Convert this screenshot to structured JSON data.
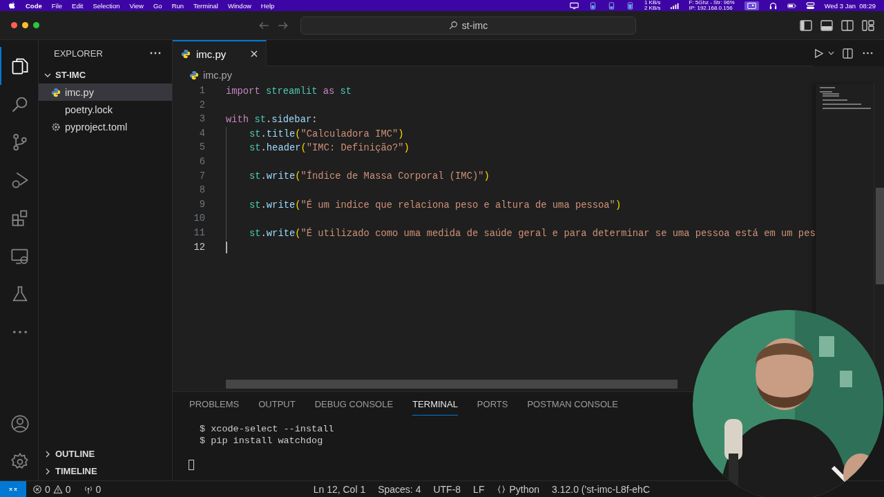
{
  "menu_bar": {
    "app": "Code",
    "items": [
      "File",
      "Edit",
      "Selection",
      "View",
      "Go",
      "Run",
      "Terminal",
      "Window",
      "Help"
    ],
    "net_speed": [
      "1 KB/s",
      "2 KB/s"
    ],
    "wifi_info": [
      "F: 5Ghz - Str: 96%",
      "IP: 192.168.0.156"
    ],
    "clock": "Wed 3 Jan  08:29"
  },
  "title_bar": {
    "search": "st-imc"
  },
  "activity_bar": {
    "items": [
      {
        "kind": "explorer",
        "selected": true
      },
      {
        "kind": "search",
        "selected": false
      },
      {
        "kind": "source-control",
        "selected": false
      },
      {
        "kind": "run-debug",
        "selected": false
      },
      {
        "kind": "extensions",
        "selected": false
      },
      {
        "kind": "remote",
        "selected": false
      },
      {
        "kind": "testing",
        "selected": false
      },
      {
        "kind": "more",
        "selected": false
      }
    ],
    "bottom": [
      {
        "kind": "account"
      },
      {
        "kind": "settings"
      }
    ]
  },
  "sidebar": {
    "title": "EXPLORER",
    "folder": {
      "name": "ST-IMC",
      "expanded": true,
      "files": [
        {
          "name": "imc.py",
          "kind": "python",
          "selected": true
        },
        {
          "name": "poetry.lock",
          "kind": "plain",
          "selected": false
        },
        {
          "name": "pyproject.toml",
          "kind": "config",
          "selected": false
        }
      ]
    },
    "sections": [
      {
        "name": "OUTLINE",
        "expanded": false
      },
      {
        "name": "TIMELINE",
        "expanded": false
      }
    ]
  },
  "editor": {
    "tabs": [
      {
        "label": "imc.py",
        "selected": true
      }
    ],
    "breadcrumb": "imc.py",
    "lines": [
      {
        "number": "1",
        "active": false,
        "tokens": [
          {
            "kind": "keyword",
            "text": "import"
          },
          {
            "kind": "module",
            "text": "streamlit"
          },
          {
            "kind": "keyword",
            "text": "as"
          },
          {
            "kind": "module",
            "text": "st"
          }
        ]
      },
      {
        "number": "2",
        "active": false
      },
      {
        "number": "3",
        "active": false,
        "tokens": [
          {
            "kind": "keyword",
            "text": "with"
          },
          {
            "kind": "module",
            "text": "st"
          },
          {
            "kind": "plain",
            "text": "."
          },
          {
            "kind": "attr",
            "text": "sidebar"
          },
          {
            "kind": "plain",
            "text": ":"
          }
        ],
        "children": [
          {
            "number": "4",
            "active": false,
            "tokens": [
              {
                "kind": "module",
                "text": "st"
              },
              {
                "kind": "plain",
                "text": "."
              },
              {
                "kind": "attr",
                "text": "title"
              },
              {
                "kind": "paren",
                "text": "("
              },
              {
                "kind": "string",
                "text": "\"Calculadora IMC\""
              },
              {
                "kind": "paren",
                "text": ")"
              }
            ]
          },
          {
            "number": "5",
            "active": false,
            "tokens": [
              {
                "kind": "module",
                "text": "st"
              },
              {
                "kind": "plain",
                "text": "."
              },
              {
                "kind": "attr",
                "text": "header"
              },
              {
                "kind": "paren",
                "text": "("
              },
              {
                "kind": "string",
                "text": "\"IMC: Definição?\""
              },
              {
                "kind": "paren",
                "text": ")"
              }
            ]
          },
          {
            "number": "6",
            "active": false
          },
          {
            "number": "7",
            "active": false,
            "tokens": [
              {
                "kind": "module",
                "text": "st"
              },
              {
                "kind": "plain",
                "text": "."
              },
              {
                "kind": "attr",
                "text": "write"
              },
              {
                "kind": "paren",
                "text": "("
              },
              {
                "kind": "string",
                "text": "\"Índice de Massa Corporal (IMC)\""
              },
              {
                "kind": "paren",
                "text": ")"
              }
            ]
          },
          {
            "number": "8",
            "active": false
          },
          {
            "number": "9",
            "active": false,
            "tokens": [
              {
                "kind": "module",
                "text": "st"
              },
              {
                "kind": "plain",
                "text": "."
              },
              {
                "kind": "attr",
                "text": "write"
              },
              {
                "kind": "paren",
                "text": "("
              },
              {
                "kind": "string",
                "text": "\"É um indice que relaciona peso e altura de uma pessoa\""
              },
              {
                "kind": "paren",
                "text": ")"
              }
            ]
          },
          {
            "number": "10",
            "active": false
          },
          {
            "number": "11",
            "active": false,
            "tokens": [
              {
                "kind": "module",
                "text": "st"
              },
              {
                "kind": "plain",
                "text": "."
              },
              {
                "kind": "attr",
                "text": "write"
              },
              {
                "kind": "paren",
                "text": "("
              },
              {
                "kind": "string",
                "text": "\"É utilizado como uma medida de saúde geral e para determinar se uma pessoa está em um pes"
              }
            ]
          }
        ]
      },
      {
        "number": "12",
        "active": true
      }
    ]
  },
  "panel": {
    "tabs": [
      {
        "label": "PROBLEMS",
        "selected": false
      },
      {
        "label": "OUTPUT",
        "selected": false
      },
      {
        "label": "DEBUG CONSOLE",
        "selected": false
      },
      {
        "label": "TERMINAL",
        "selected": true
      },
      {
        "label": "PORTS",
        "selected": false
      },
      {
        "label": "POSTMAN CONSOLE",
        "selected": false
      }
    ],
    "terminal_lines": [
      "$ xcode-select --install",
      "$ pip install watchdog"
    ]
  },
  "status_bar": {
    "errors": "0",
    "warnings": "0",
    "ports": "0",
    "position": "Ln 12, Col 1",
    "indentation": "Spaces: 4",
    "encoding": "UTF-8",
    "eol": "LF",
    "language": "Python",
    "interpreter": "3.12.0 ('st-imc-L8f-ehC"
  }
}
